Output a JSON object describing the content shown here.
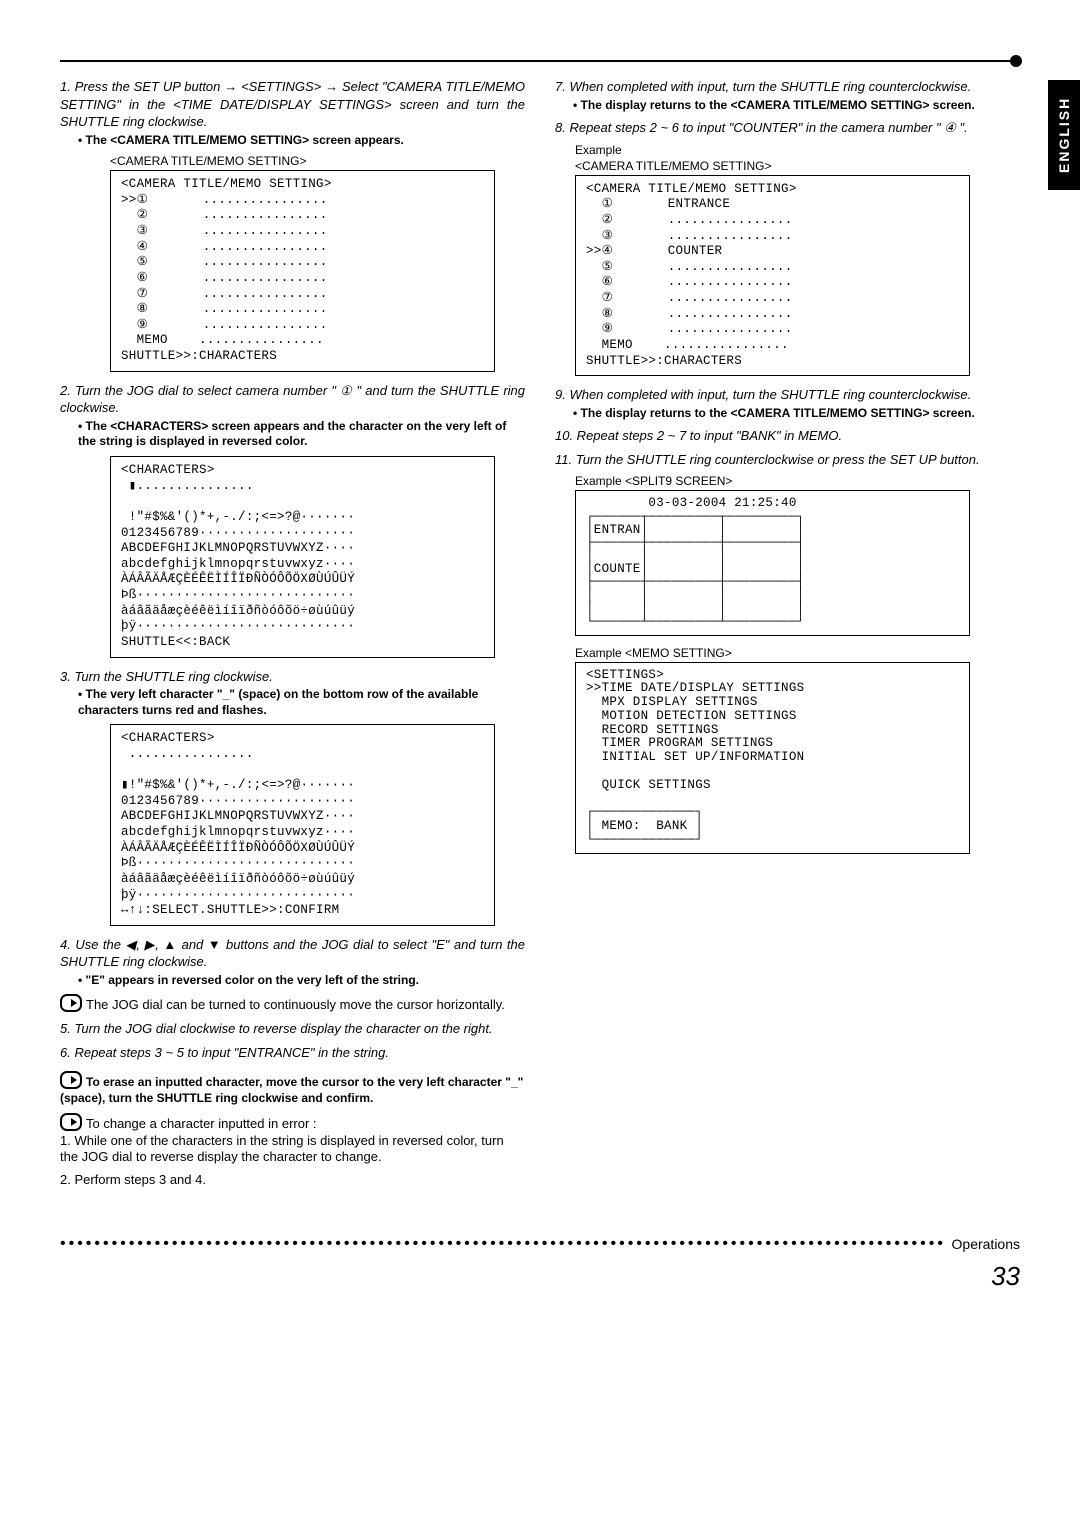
{
  "sideTab": "ENGLISH",
  "left": {
    "step1": "1. Press the SET UP button → <SETTINGS> → Select \"CAMERA TITLE/MEMO SETTING\" in the <TIME DATE/DISPLAY SETTINGS> screen and turn the SHUTTLE ring clockwise.",
    "b1": "• The <CAMERA TITLE/MEMO SETTING> screen appears.",
    "screen1_label": "<CAMERA TITLE/MEMO SETTING>",
    "screen1": "<CAMERA TITLE/MEMO SETTING>\n>>①       ................\n  ②       ................\n  ③       ................\n  ④       ................\n  ⑤       ................\n  ⑥       ................\n  ⑦       ................\n  ⑧       ................\n  ⑨       ................\n  MEMO    ................\nSHUTTLE>>:CHARACTERS",
    "step2": "2. Turn the JOG dial to select camera number \" ① \" and turn the SHUTTLE ring clockwise.",
    "b2": "• The <CHARACTERS> screen appears and the character on the very left of the string is displayed in reversed color.",
    "screen2": "<CHARACTERS>\n ▮...............\n\n !\"#$%&'()*+,-./:;<=>?@·······\n0123456789····················\nABCDEFGHIJKLMNOPQRSTUVWXYZ····\nabcdefghijklmnopqrstuvwxyz····\nÀÁÂÃÄÅÆÇÈÉÊËÌÍÎÏÐÑÒÓÔÕÖXØÙÚÛÜÝ\nÞß····························\nàáâãäåæçèéêëìíîïðñòóôõö÷øùúûüý\nþÿ····························\nSHUTTLE<<:BACK",
    "step3": "3. Turn the SHUTTLE ring clockwise.",
    "b3": "• The very left character \"_\" (space) on the bottom row of the available characters turns red and flashes.",
    "screen3": "<CHARACTERS>\n ................\n\n▮!\"#$%&'()*+,-./:;<=>?@·······\n0123456789····················\nABCDEFGHIJKLMNOPQRSTUVWXYZ····\nabcdefghijklmnopqrstuvwxyz····\nÀÁÂÃÄÅÆÇÈÉÊËÌÍÎÏÐÑÒÓÔÕÖXØÙÚÛÜÝ\nÞß····························\nàáâãäåæçèéêëìíîïðñòóôõö÷øùúûüý\nþÿ····························\n↔↑↓:SELECT.SHUTTLE>>:CONFIRM",
    "step4": "4. Use the ◀, ▶, ▲ and ▼ buttons and the JOG dial to select \"E\" and turn the SHUTTLE ring clockwise.",
    "b4": "• \"E\" appears in reversed color on the very left of the string.",
    "note1": "The JOG dial can be turned to continuously move the cursor horizontally.",
    "step5": "5. Turn the JOG dial clockwise to reverse display the character on the right.",
    "step6": "6. Repeat steps 3 ~ 5 to input \"ENTRANCE\" in the string.",
    "note2": "To erase an inputted character, move the cursor to the very left character \"_\" (space), turn the SHUTTLE ring clockwise and confirm.",
    "note3a": "To change a character inputted in error :",
    "note3b": "1. While one of the characters in the string is displayed in reversed color, turn the JOG dial to reverse display the character to change.",
    "note3c": "2. Perform steps 3 and 4."
  },
  "right": {
    "step7": "7. When completed with input, turn the SHUTTLE ring counterclockwise.",
    "b7": "• The display returns to the <CAMERA TITLE/MEMO SETTING> screen.",
    "step8": "8. Repeat steps 2 ~ 6 to input \"COUNTER\" in the camera number \" ④ \".",
    "ex_label": "Example",
    "screenR1_label": "<CAMERA TITLE/MEMO SETTING>",
    "screenR1": "<CAMERA TITLE/MEMO SETTING>\n  ①       ENTRANCE\n  ②       ................\n  ③       ................\n>>④       COUNTER\n  ⑤       ................\n  ⑥       ................\n  ⑦       ................\n  ⑧       ................\n  ⑨       ................\n  MEMO    ................\nSHUTTLE>>:CHARACTERS",
    "step9": "9. When completed  with input, turn the SHUTTLE ring counterclockwise.",
    "b9": "• The display returns to the <CAMERA TITLE/MEMO SETTING> screen.",
    "step10": "10. Repeat steps 2 ~ 7 to input \"BANK\" in MEMO.",
    "step11": "11. Turn the SHUTTLE ring counterclockwise or press the SET UP button.",
    "screenR2_label": "Example  <SPLIT9 SCREEN>",
    "screenR2": "        03-03-2004 21:25:40\n┌──────┬─────────┬─────────┐\n│ENTRAN│         │         │\n├──────┼─────────┼─────────┤\n│      │         │         │\n│COUNTE│         │         │\n├──────┼─────────┼─────────┤\n│      │         │         │\n│      │         │         │\n└──────┴─────────┴─────────┘",
    "screenR3_label": "Example <MEMO SETTING>",
    "screenR3": "<SETTINGS>\n>>TIME DATE/DISPLAY SETTINGS\n  MPX DISPLAY SETTINGS\n  MOTION DETECTION SETTINGS\n  RECORD SETTINGS\n  TIMER PROGRAM SETTINGS\n  INITIAL SET UP/INFORMATION\n\n  QUICK SETTINGS\n\n┌─────────────┐\n│ MEMO:  BANK │\n└─────────────┘"
  },
  "footer": {
    "ops": "Operations",
    "page": "33"
  }
}
